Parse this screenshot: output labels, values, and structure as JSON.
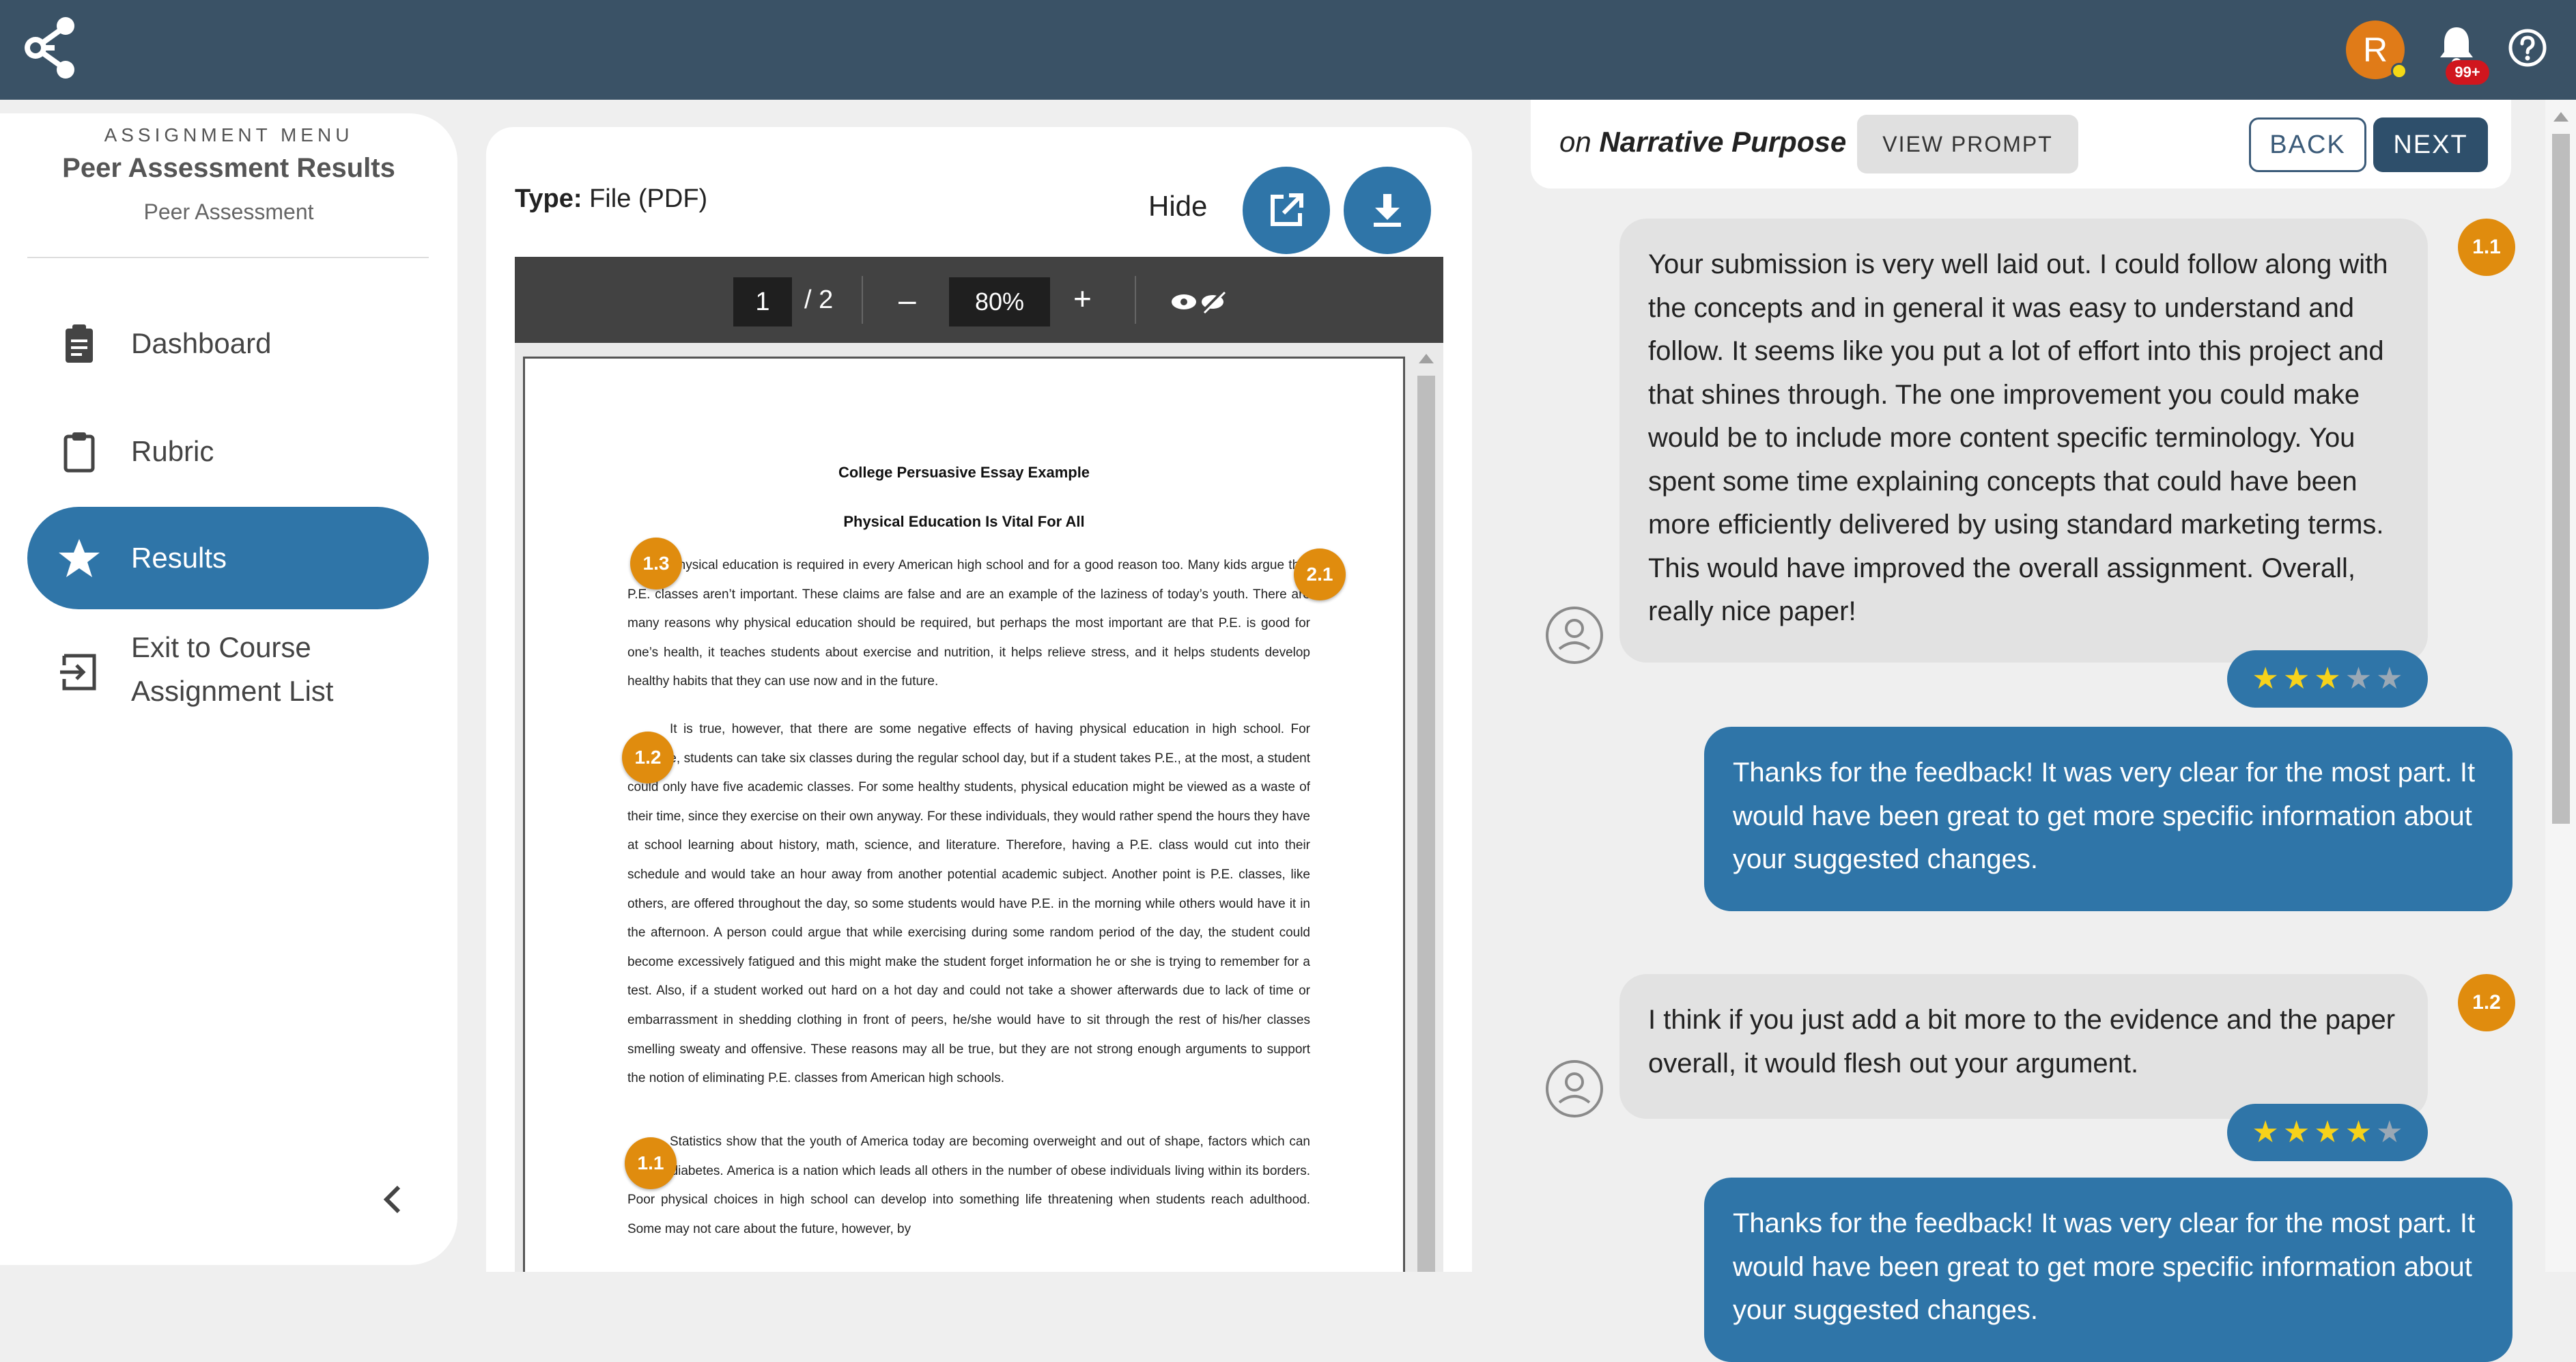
{
  "app": {
    "user_initial": "R",
    "notification_count": "99+"
  },
  "sidebar": {
    "caption": "ASSIGNMENT MENU",
    "title": "Peer Assessment Results",
    "subtitle": "Peer Assessment",
    "items": [
      {
        "label": "Dashboard",
        "icon": "clipboard-icon",
        "active": false
      },
      {
        "label": "Rubric",
        "icon": "clipboard-outline-icon",
        "active": false
      },
      {
        "label": "Results",
        "icon": "star-icon",
        "active": true
      },
      {
        "label_line1": "Exit to Course",
        "label_line2": "Assignment List",
        "icon": "exit-icon",
        "active": false
      }
    ]
  },
  "document": {
    "type_label": "Type:",
    "type_value": "File (PDF)",
    "hide_label": "Hide",
    "page_current": "1",
    "page_total": "/ 2",
    "zoom_minus": "–",
    "zoom": "80%",
    "zoom_plus": "+",
    "title": "College Persuasive Essay Example",
    "subtitle": "Physical Education Is Vital For All",
    "paragraphs": [
      "Physical education is required in every American high school and for a good reason too. Many kids argue that P.E. classes aren’t important. These claims are false and are an example of the laziness of today’s youth. There are many reasons why physical education should be required, but perhaps the most important are that P.E. is good for one’s health, it teaches students about exercise and nutrition, it helps relieve stress, and it helps students develop healthy habits that they can use now and in the future.",
      "It is true, however, that there are some negative effects of having physical education in high school. For example, students can take six classes during the regular school day, but if a student takes P.E., at the most, a student could only have five academic classes. For some healthy students, physical education might be viewed as a waste of their time, since they exercise on their own anyway. For these individuals, they would rather spend the hours they have at school learning about history, math, science, and literature. Therefore, having a P.E. class would cut into their schedule and would take an hour away from another potential academic subject. Another point is P.E. classes, like others, are offered throughout the day, so some students would have P.E. in the morning while others would have it in the afternoon. A person could argue that while exercising during some random period of the day, the student could become excessively fatigued and this might make the student forget information he or she is trying to remember for a test. Also, if a student worked out hard on a hot day and could not take a shower afterwards due to lack of time or embarrassment in shedding clothing in front of peers, he/she would have to sit through the rest of his/her classes smelling sweaty and offensive. These reasons may all be true, but they are not strong enough arguments to support the notion of eliminating P.E. classes from American high schools.",
      "Statistics show that the youth of America today are becoming overweight and out of shape, factors which can lead to diabetes. America is a nation which leads all others in the number of obese individuals living within its borders. Poor physical choices in high school can develop into something life threatening when students reach adulthood. Some may not care about the future, however, by"
    ],
    "markers": [
      "1.3",
      "2.1",
      "1.2",
      "1.1"
    ]
  },
  "feedback": {
    "on_label": "on",
    "criterion": "Narrative Purpose",
    "view_prompt": "VIEW PROMPT",
    "back": "BACK",
    "next": "NEXT",
    "reviews": [
      {
        "tag": "1.1",
        "text": "Your submission is very well laid out. I could follow along with the concepts and in general it was easy to understand and follow. It seems like you put a lot of effort into this project and that shines through. The one improvement you could make would be to include more content specific terminology. You spent some time explaining concepts that could have been more efficiently delivered by using standard marketing terms. This would have improved the overall assignment. Overall, really nice paper!",
        "rating": 3,
        "max_rating": 5,
        "reply": "Thanks for the feedback! It was very clear for the most part. It would have been great to get more specific information about your suggested changes."
      },
      {
        "tag": "1.2",
        "text": "I think if you just add a bit more to the evidence and the paper overall, it would flesh out your argument.",
        "rating": 4,
        "max_rating": 5,
        "reply": "Thanks for the feedback! It was very clear for the most part. It would have been great to get more specific information about your suggested changes."
      }
    ]
  }
}
